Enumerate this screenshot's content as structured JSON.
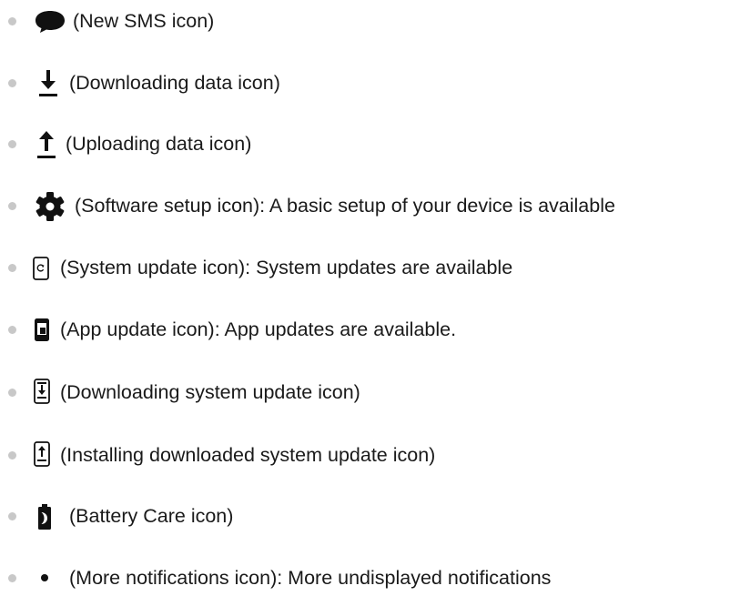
{
  "items": [
    {
      "icon": "new-sms-icon",
      "text": "(New SMS icon)"
    },
    {
      "icon": "download-arrow-icon",
      "text": "(Downloading data icon)"
    },
    {
      "icon": "upload-arrow-icon",
      "text": "(Uploading data icon)"
    },
    {
      "icon": "gear-icon",
      "text": "(Software setup icon): A basic setup of your device is available"
    },
    {
      "icon": "system-update-icon",
      "text": "(System update icon): System updates are available"
    },
    {
      "icon": "app-update-icon",
      "text": "(App update icon): App updates are available."
    },
    {
      "icon": "downloading-system-update-icon",
      "text": "(Downloading system update icon)"
    },
    {
      "icon": "installing-system-update-icon",
      "text": "(Installing downloaded system update icon)"
    },
    {
      "icon": "battery-care-icon",
      "text": "(Battery Care icon)"
    },
    {
      "icon": "more-notifications-dot-icon",
      "text": "(More notifications icon): More undisplayed notifications"
    }
  ],
  "colors": {
    "text": "#1a1a1a",
    "bullet": "#c8c8c8",
    "icon": "#111111"
  }
}
